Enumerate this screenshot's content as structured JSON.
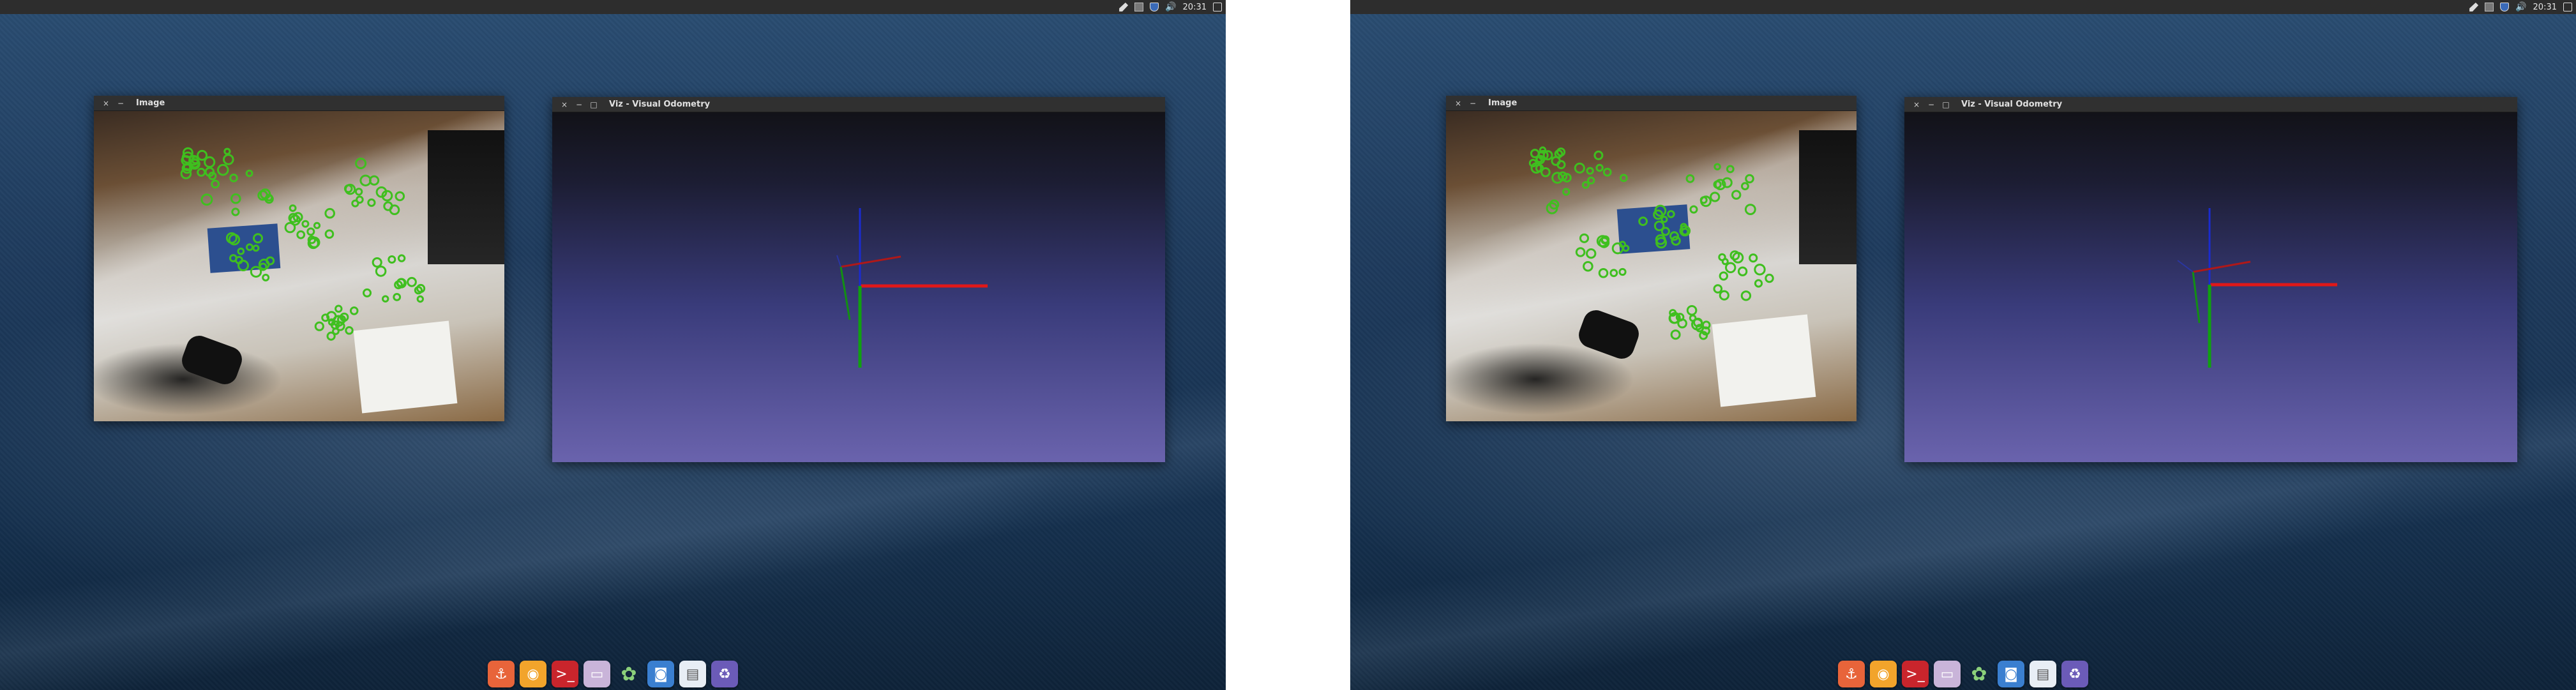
{
  "screens": [
    {
      "tray": {
        "clock": "20:31"
      },
      "image_window": {
        "title": "Image",
        "close": "×",
        "min": "−"
      },
      "viz_window": {
        "title": "Viz - Visual Odometry",
        "close": "×",
        "min": "−",
        "max": "□"
      }
    },
    {
      "tray": {
        "clock": "20:31"
      },
      "image_window": {
        "title": "Image",
        "close": "×",
        "min": "−"
      },
      "viz_window": {
        "title": "Viz - Visual Odometry",
        "close": "×",
        "min": "−",
        "max": "□"
      }
    }
  ],
  "dock": {
    "icons": [
      {
        "name": "anchor-icon",
        "glyph": "⚓"
      },
      {
        "name": "firefox-icon",
        "glyph": "◉"
      },
      {
        "name": "terminal-icon",
        "glyph": ">_"
      },
      {
        "name": "files-folder-icon",
        "glyph": "▭"
      },
      {
        "name": "system-settings-icon",
        "glyph": "✿"
      },
      {
        "name": "camera-icon",
        "glyph": "◙"
      },
      {
        "name": "window-manager-icon",
        "glyph": "▤"
      },
      {
        "name": "trash-icon",
        "glyph": "♻"
      }
    ]
  },
  "colors": {
    "feature_point": "#3fbf1f",
    "axis_x": "#e01818",
    "axis_y": "#10a010",
    "axis_z": "#1a2bd0"
  }
}
